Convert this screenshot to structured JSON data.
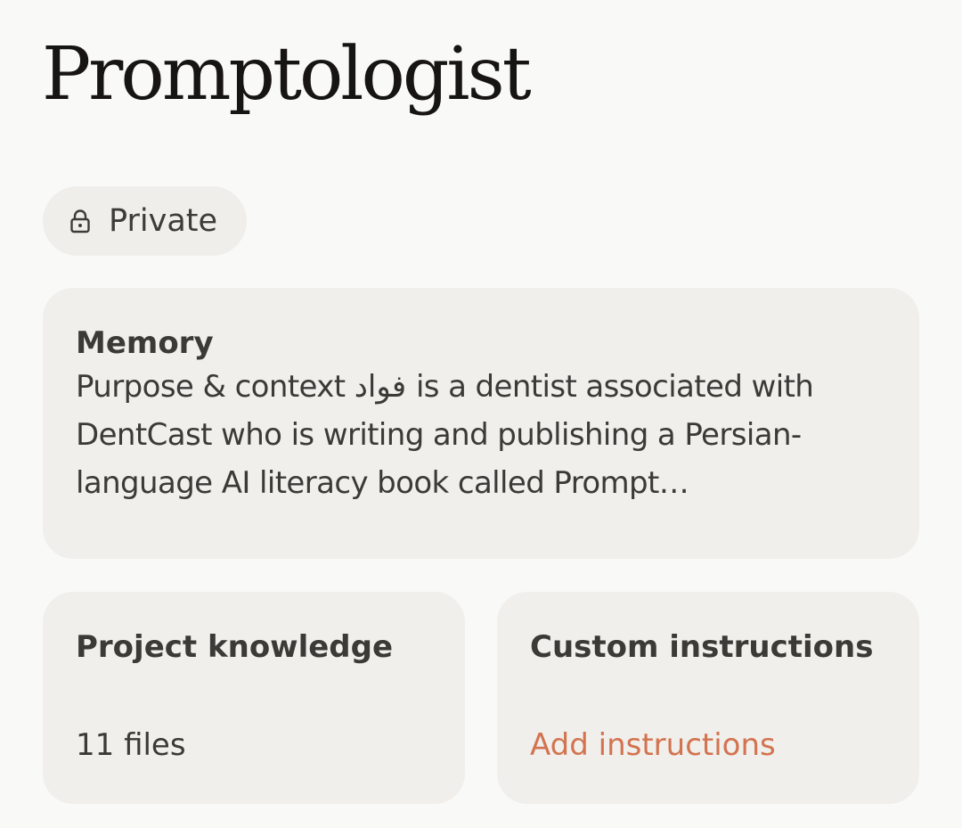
{
  "project": {
    "title": "Promptologist",
    "visibility": {
      "label": "Private",
      "icon": "lock-icon"
    }
  },
  "memory": {
    "heading": "Memory",
    "summary": "Purpose & context فواد is a dentist associated with DentCast who is writing and publishing a Persian-language AI literacy book called Prompt…"
  },
  "knowledge": {
    "heading": "Project knowledge",
    "files_label": "11 files"
  },
  "instructions": {
    "heading": "Custom instructions",
    "action_label": "Add instructions"
  },
  "colors": {
    "background": "#f9f9f7",
    "card": "#f0efec",
    "text": "#3b3a37",
    "title": "#161513",
    "accent": "#d3734f"
  }
}
